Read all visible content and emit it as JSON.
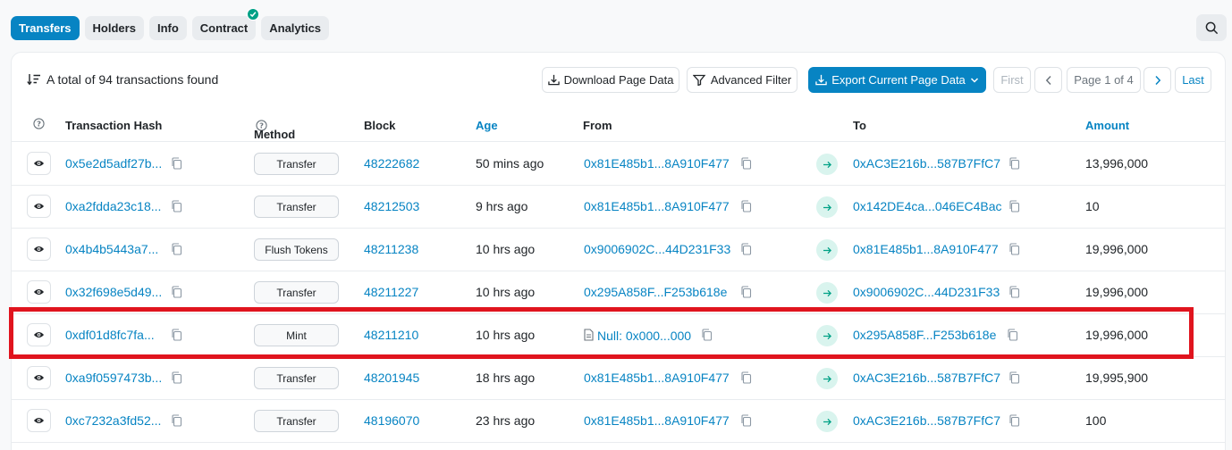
{
  "tabs": [
    {
      "label": "Transfers"
    },
    {
      "label": "Holders"
    },
    {
      "label": "Info"
    },
    {
      "label": "Contract"
    },
    {
      "label": "Analytics"
    }
  ],
  "summary": "A total of 94 transactions found",
  "toolbar": {
    "download": "Download Page Data",
    "filter": "Advanced Filter",
    "export": "Export Current Page Data"
  },
  "pagination": {
    "first": "First",
    "page": "Page 1 of 4",
    "last": "Last"
  },
  "columns": {
    "hash": "Transaction Hash",
    "method": "Method",
    "block": "Block",
    "age": "Age",
    "from": "From",
    "to": "To",
    "amount": "Amount"
  },
  "rows": [
    {
      "hash": "0x5e2d5adf27b...",
      "method": "Transfer",
      "block": "48222682",
      "age": "50 mins ago",
      "from": "0x81E485b1...8A910F477",
      "to": "0xAC3E216b...587B7FfC7",
      "amount": "13,996,000"
    },
    {
      "hash": "0xa2fdda23c18...",
      "method": "Transfer",
      "block": "48212503",
      "age": "9 hrs ago",
      "from": "0x81E485b1...8A910F477",
      "to": "0x142DE4ca...046EC4Bac",
      "amount": "10"
    },
    {
      "hash": "0x4b4b5443a7...",
      "method": "Flush Tokens",
      "block": "48211238",
      "age": "10 hrs ago",
      "from": "0x9006902C...44D231F33",
      "to": "0x81E485b1...8A910F477",
      "amount": "19,996,000"
    },
    {
      "hash": "0x32f698e5d49...",
      "method": "Transfer",
      "block": "48211227",
      "age": "10 hrs ago",
      "from": "0x295A858F...F253b618e",
      "to": "0x9006902C...44D231F33",
      "amount": "19,996,000"
    },
    {
      "hash": "0xdf01d8fc7fa...",
      "method": "Mint",
      "block": "48211210",
      "age": "10 hrs ago",
      "from": "Null: 0x000...000",
      "to": "0x295A858F...F253b618e",
      "amount": "19,996,000",
      "from_is_contract": true
    },
    {
      "hash": "0xa9f0597473b...",
      "method": "Transfer",
      "block": "48201945",
      "age": "18 hrs ago",
      "from": "0x81E485b1...8A910F477",
      "to": "0xAC3E216b...587B7FfC7",
      "amount": "19,995,900"
    },
    {
      "hash": "0xc7232a3fd52...",
      "method": "Transfer",
      "block": "48196070",
      "age": "23 hrs ago",
      "from": "0x81E485b1...8A910F477",
      "to": "0xAC3E216b...587B7FfC7",
      "amount": "100"
    }
  ],
  "colors": {
    "accent": "#0784c3",
    "highlight": "#e0141e",
    "success": "#00a186"
  }
}
